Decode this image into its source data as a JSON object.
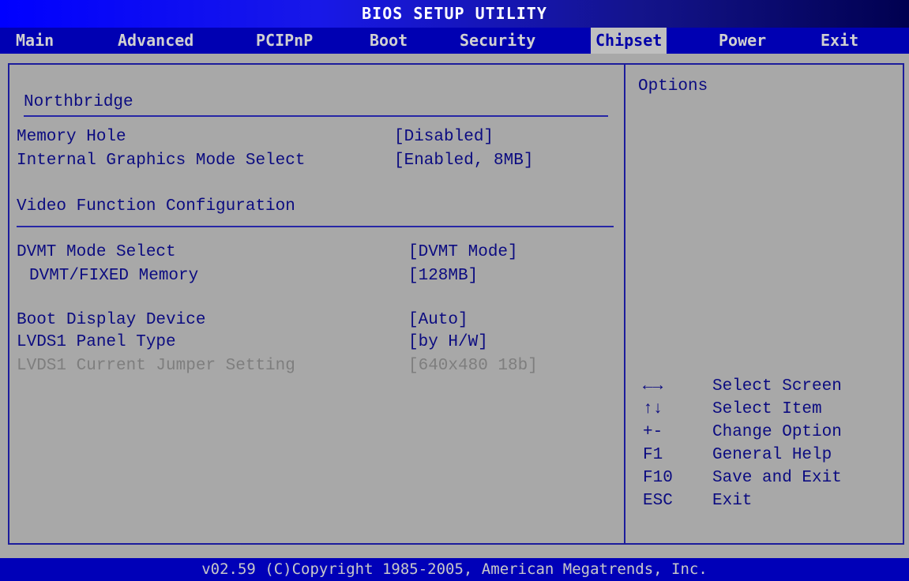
{
  "title": "BIOS SETUP UTILITY",
  "menu": {
    "items": [
      {
        "label": "Main"
      },
      {
        "label": "Advanced"
      },
      {
        "label": "PCIPnP"
      },
      {
        "label": "Boot"
      },
      {
        "label": "Security"
      },
      {
        "label": "Chipset"
      },
      {
        "label": "Power"
      },
      {
        "label": "Exit"
      }
    ],
    "active": "Chipset"
  },
  "section": {
    "title": "Northbridge",
    "subheading": "Video Function Configuration"
  },
  "settings": {
    "memory_hole": {
      "label": "Memory Hole",
      "value": "[Disabled]"
    },
    "igd_mode": {
      "label": "Internal Graphics Mode Select",
      "value": "[Enabled, 8MB]"
    },
    "dvmt_mode": {
      "label": "DVMT Mode Select",
      "value": "[DVMT Mode]"
    },
    "dvmt_memory": {
      "label": "DVMT/FIXED Memory",
      "value": "[128MB]"
    },
    "boot_display": {
      "label": "Boot Display Device",
      "value": "[Auto]"
    },
    "lvds_panel": {
      "label": "LVDS1 Panel Type",
      "value": "[by H/W]"
    },
    "lvds_jumper": {
      "label": "LVDS1 Current Jumper Setting",
      "value": "[640x480 18b]"
    }
  },
  "help": {
    "title": "Options",
    "keys": [
      {
        "key": "←→",
        "action": "Select Screen"
      },
      {
        "key": "↑↓",
        "action": "Select Item"
      },
      {
        "key": "+-",
        "action": "Change Option"
      },
      {
        "key": "F1",
        "action": "General Help"
      },
      {
        "key": "F10",
        "action": "Save and Exit"
      },
      {
        "key": "ESC",
        "action": "Exit"
      }
    ]
  },
  "footer": "v02.59 (C)Copyright 1985-2005, American Megatrends, Inc.",
  "colors": {
    "title_bar": "#0000ff",
    "menu_bar": "#0000b2",
    "active_menu_bg": "#bfbfbf",
    "panel_bg": "#a8a8a8",
    "text": "#0b0b80",
    "dim_text": "#7e7e7e",
    "border": "#1c1c9c"
  }
}
